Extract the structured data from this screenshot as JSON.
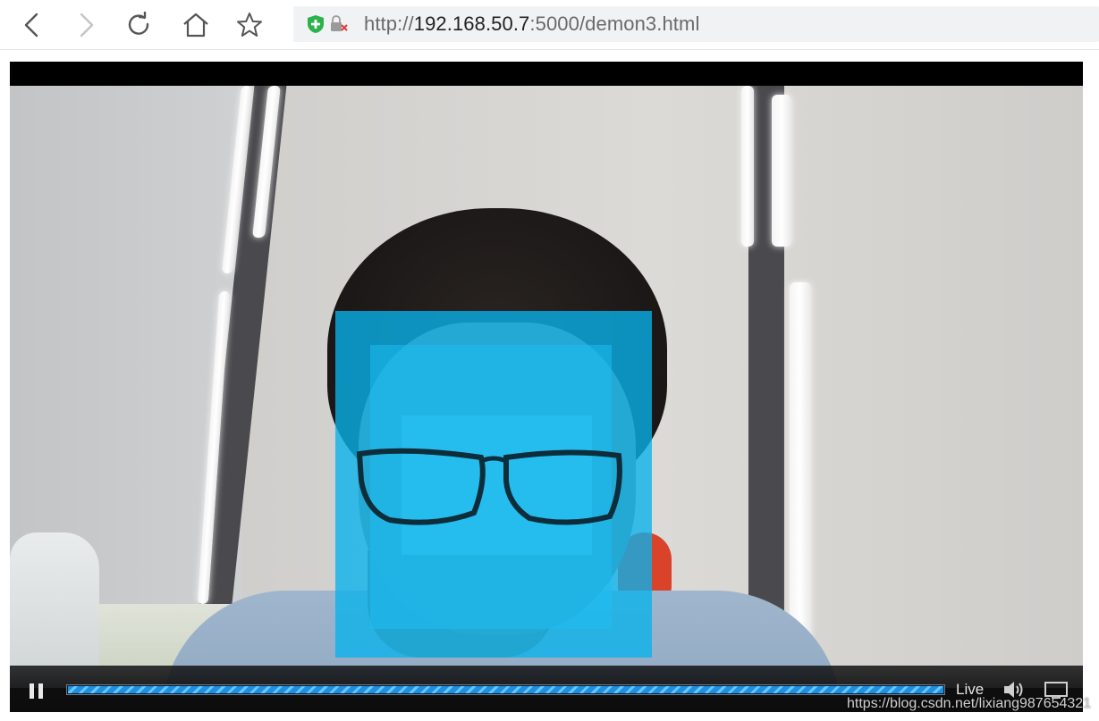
{
  "browser": {
    "url_scheme": "http://",
    "url_host": "192.168.50.7",
    "url_rest": ":5000/demon3.html",
    "buttons": {
      "back": "back-icon",
      "forward": "forward-icon",
      "reload": "reload-icon",
      "home": "home-icon",
      "bookmark": "star-icon"
    },
    "security_icons": [
      "shield-plus-icon",
      "insecure-lock-icon"
    ]
  },
  "player": {
    "state": "playing",
    "live_label": "Live",
    "progress_fraction": 1.0,
    "icons": {
      "pause": "pause-icon",
      "volume": "volume-icon",
      "fullscreen": "screen-icon"
    },
    "detection_color": "#0ab4ee"
  },
  "watermark": "https://blog.csdn.net/lixiang987654321"
}
